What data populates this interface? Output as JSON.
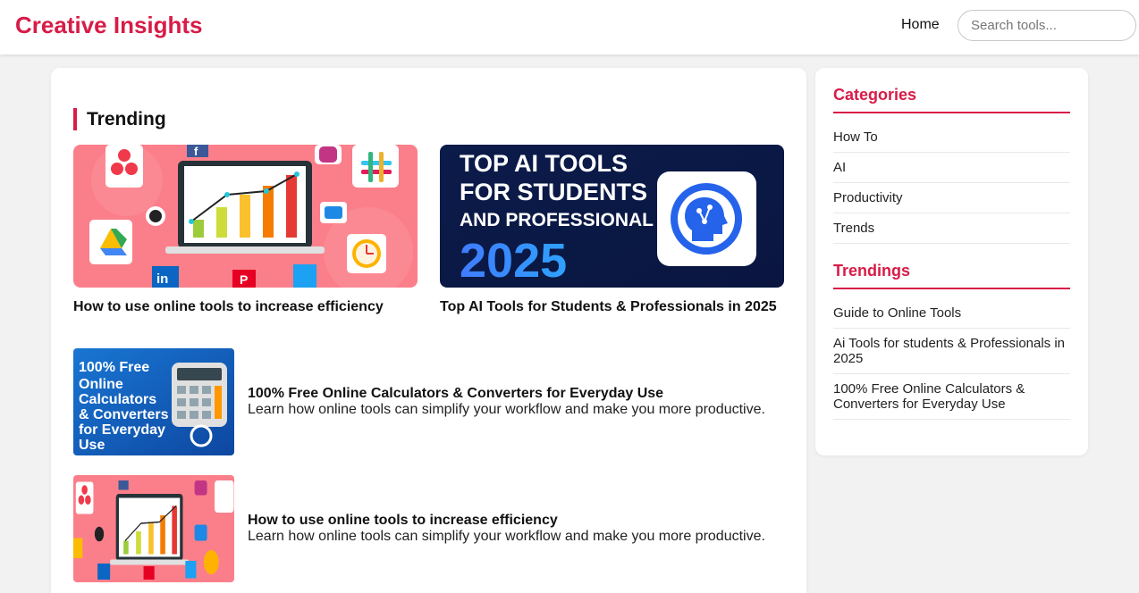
{
  "header": {
    "brand": "Creative Insights",
    "nav_home": "Home",
    "search_placeholder": "Search tools..."
  },
  "trending": {
    "title": "Trending",
    "cards": [
      {
        "title": "How to use online tools to increase efficiency"
      },
      {
        "title": "Top AI Tools for Students & Professionals in 2025",
        "banner": {
          "line1": "TOP AI TOOLS",
          "line2": "FOR STUDENTS",
          "line3": "AND PROFESSIONAL",
          "year": "2025"
        }
      }
    ]
  },
  "articles": [
    {
      "title": "100% Free Online Calculators & Converters for Everyday Use",
      "description": "Learn how online tools can simplify your workflow and make you more productive.",
      "thumb_text": [
        "100% Free",
        "Online",
        "Calculators",
        "& Converters",
        "for Everyday",
        "Use"
      ]
    },
    {
      "title": "How to use online tools to increase efficiency",
      "description": "Learn how online tools can simplify your workflow and make you more productive."
    }
  ],
  "sidebar": {
    "categories_title": "Categories",
    "categories": [
      "How To",
      "AI",
      "Productivity",
      "Trends"
    ],
    "trendings_title": "Trendings",
    "trendings": [
      "Guide to Online Tools",
      "Ai Tools for students & Professionals in 2025",
      "100% Free Online Calculators & Converters for Everyday Use"
    ]
  },
  "colors": {
    "accent": "#d81b47",
    "background": "#f2f2f2",
    "card": "#ffffff"
  }
}
